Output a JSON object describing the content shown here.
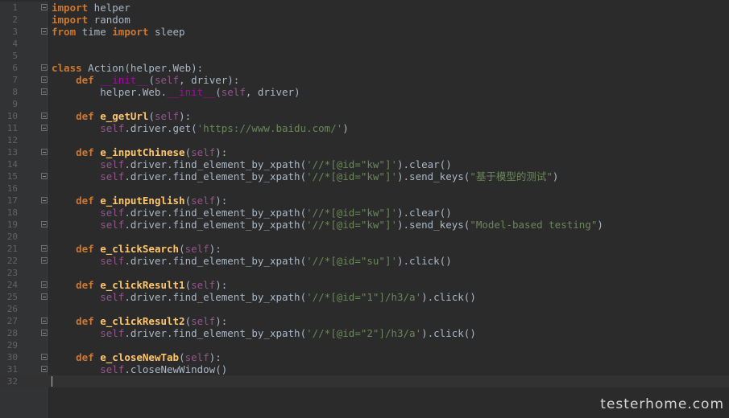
{
  "editor": {
    "lines": [
      {
        "n": "1",
        "fold": true,
        "tokens": [
          [
            "keyword",
            "import"
          ],
          [
            "plain",
            " helper"
          ]
        ]
      },
      {
        "n": "2",
        "fold": false,
        "tokens": [
          [
            "keyword",
            "import"
          ],
          [
            "plain",
            " random"
          ]
        ]
      },
      {
        "n": "3",
        "fold": true,
        "tokens": [
          [
            "keyword",
            "from"
          ],
          [
            "plain",
            " time "
          ],
          [
            "keyword",
            "import"
          ],
          [
            "plain",
            " sleep"
          ]
        ]
      },
      {
        "n": "4",
        "fold": false,
        "tokens": []
      },
      {
        "n": "5",
        "fold": false,
        "tokens": []
      },
      {
        "n": "6",
        "fold": true,
        "tokens": [
          [
            "keyword",
            "class"
          ],
          [
            "plain",
            " Action(helper.Web):"
          ]
        ]
      },
      {
        "n": "7",
        "fold": true,
        "tokens": [
          [
            "plain",
            "    "
          ],
          [
            "keyword",
            "def"
          ],
          [
            "plain",
            " "
          ],
          [
            "dunder",
            "__init__"
          ],
          [
            "plain",
            "("
          ],
          [
            "self",
            "self"
          ],
          [
            "plain",
            ", driver):"
          ]
        ]
      },
      {
        "n": "8",
        "fold": true,
        "tokens": [
          [
            "plain",
            "        helper.Web."
          ],
          [
            "dunder",
            "__init__"
          ],
          [
            "plain",
            "("
          ],
          [
            "self",
            "self"
          ],
          [
            "plain",
            ", driver)"
          ]
        ]
      },
      {
        "n": "9",
        "fold": false,
        "tokens": []
      },
      {
        "n": "10",
        "fold": true,
        "tokens": [
          [
            "plain",
            "    "
          ],
          [
            "keyword",
            "def"
          ],
          [
            "plain",
            " "
          ],
          [
            "funcname",
            "e_getUrl"
          ],
          [
            "plain",
            "("
          ],
          [
            "self",
            "self"
          ],
          [
            "plain",
            "):"
          ]
        ]
      },
      {
        "n": "11",
        "fold": true,
        "tokens": [
          [
            "plain",
            "        "
          ],
          [
            "self",
            "self"
          ],
          [
            "plain",
            ".driver.get("
          ],
          [
            "string",
            "'https://www.baidu.com/'"
          ],
          [
            "plain",
            ")"
          ]
        ]
      },
      {
        "n": "12",
        "fold": false,
        "tokens": []
      },
      {
        "n": "13",
        "fold": true,
        "tokens": [
          [
            "plain",
            "    "
          ],
          [
            "keyword",
            "def"
          ],
          [
            "plain",
            " "
          ],
          [
            "funcname",
            "e_inputChinese"
          ],
          [
            "plain",
            "("
          ],
          [
            "self",
            "self"
          ],
          [
            "plain",
            "):"
          ]
        ]
      },
      {
        "n": "14",
        "fold": false,
        "tokens": [
          [
            "plain",
            "        "
          ],
          [
            "self",
            "self"
          ],
          [
            "plain",
            ".driver.find_element_by_xpath("
          ],
          [
            "string",
            "'//*[@id=\"kw\"]'"
          ],
          [
            "plain",
            ").clear()"
          ]
        ]
      },
      {
        "n": "15",
        "fold": true,
        "tokens": [
          [
            "plain",
            "        "
          ],
          [
            "self",
            "self"
          ],
          [
            "plain",
            ".driver.find_element_by_xpath("
          ],
          [
            "string",
            "'//*[@id=\"kw\"]'"
          ],
          [
            "plain",
            ").send_keys("
          ],
          [
            "string",
            "\"基于模型的测试\""
          ],
          [
            "plain",
            ")"
          ]
        ]
      },
      {
        "n": "16",
        "fold": false,
        "tokens": []
      },
      {
        "n": "17",
        "fold": true,
        "tokens": [
          [
            "plain",
            "    "
          ],
          [
            "keyword",
            "def"
          ],
          [
            "plain",
            " "
          ],
          [
            "funcname",
            "e_inputEnglish"
          ],
          [
            "plain",
            "("
          ],
          [
            "self",
            "self"
          ],
          [
            "plain",
            "):"
          ]
        ]
      },
      {
        "n": "18",
        "fold": false,
        "tokens": [
          [
            "plain",
            "        "
          ],
          [
            "self",
            "self"
          ],
          [
            "plain",
            ".driver.find_element_by_xpath("
          ],
          [
            "string",
            "'//*[@id=\"kw\"]'"
          ],
          [
            "plain",
            ").clear()"
          ]
        ]
      },
      {
        "n": "19",
        "fold": true,
        "tokens": [
          [
            "plain",
            "        "
          ],
          [
            "self",
            "self"
          ],
          [
            "plain",
            ".driver.find_element_by_xpath("
          ],
          [
            "string",
            "'//*[@id=\"kw\"]'"
          ],
          [
            "plain",
            ").send_keys("
          ],
          [
            "string",
            "\"Model-based testing\""
          ],
          [
            "plain",
            ")"
          ]
        ]
      },
      {
        "n": "20",
        "fold": false,
        "tokens": []
      },
      {
        "n": "21",
        "fold": true,
        "tokens": [
          [
            "plain",
            "    "
          ],
          [
            "keyword",
            "def"
          ],
          [
            "plain",
            " "
          ],
          [
            "funcname",
            "e_clickSearch"
          ],
          [
            "plain",
            "("
          ],
          [
            "self",
            "self"
          ],
          [
            "plain",
            "):"
          ]
        ]
      },
      {
        "n": "22",
        "fold": true,
        "tokens": [
          [
            "plain",
            "        "
          ],
          [
            "self",
            "self"
          ],
          [
            "plain",
            ".driver.find_element_by_xpath("
          ],
          [
            "string",
            "'//*[@id=\"su\"]'"
          ],
          [
            "plain",
            ").click()"
          ]
        ]
      },
      {
        "n": "23",
        "fold": false,
        "tokens": []
      },
      {
        "n": "24",
        "fold": true,
        "tokens": [
          [
            "plain",
            "    "
          ],
          [
            "keyword",
            "def"
          ],
          [
            "plain",
            " "
          ],
          [
            "funcname",
            "e_clickResult1"
          ],
          [
            "plain",
            "("
          ],
          [
            "self",
            "self"
          ],
          [
            "plain",
            "):"
          ]
        ]
      },
      {
        "n": "25",
        "fold": true,
        "tokens": [
          [
            "plain",
            "        "
          ],
          [
            "self",
            "self"
          ],
          [
            "plain",
            ".driver.find_element_by_xpath("
          ],
          [
            "string",
            "'//*[@id=\"1\"]/h3/a'"
          ],
          [
            "plain",
            ").click()"
          ]
        ]
      },
      {
        "n": "26",
        "fold": false,
        "tokens": []
      },
      {
        "n": "27",
        "fold": true,
        "tokens": [
          [
            "plain",
            "    "
          ],
          [
            "keyword",
            "def"
          ],
          [
            "plain",
            " "
          ],
          [
            "funcname",
            "e_clickResult2"
          ],
          [
            "plain",
            "("
          ],
          [
            "self",
            "self"
          ],
          [
            "plain",
            "):"
          ]
        ]
      },
      {
        "n": "28",
        "fold": true,
        "tokens": [
          [
            "plain",
            "        "
          ],
          [
            "self",
            "self"
          ],
          [
            "plain",
            ".driver.find_element_by_xpath("
          ],
          [
            "string",
            "'//*[@id=\"2\"]/h3/a'"
          ],
          [
            "plain",
            ").click()"
          ]
        ]
      },
      {
        "n": "29",
        "fold": false,
        "tokens": []
      },
      {
        "n": "30",
        "fold": true,
        "tokens": [
          [
            "plain",
            "    "
          ],
          [
            "keyword",
            "def"
          ],
          [
            "plain",
            " "
          ],
          [
            "funcname",
            "e_closeNewTab"
          ],
          [
            "plain",
            "("
          ],
          [
            "self",
            "self"
          ],
          [
            "plain",
            "):"
          ]
        ]
      },
      {
        "n": "31",
        "fold": true,
        "tokens": [
          [
            "plain",
            "        "
          ],
          [
            "self",
            "self"
          ],
          [
            "plain",
            ".closeNewWindow()"
          ]
        ]
      },
      {
        "n": "32",
        "fold": false,
        "current": true,
        "tokens": []
      }
    ]
  },
  "watermark": "testerhome.com",
  "colors": {
    "background": "#2b2b2b",
    "gutter": "#313335",
    "keyword": "#cc7832",
    "string": "#6a8759",
    "self": "#94558d",
    "dunder": "#b200b2",
    "function_name": "#ffc66d",
    "plain": "#a9b7c6",
    "line_number": "#606366"
  }
}
